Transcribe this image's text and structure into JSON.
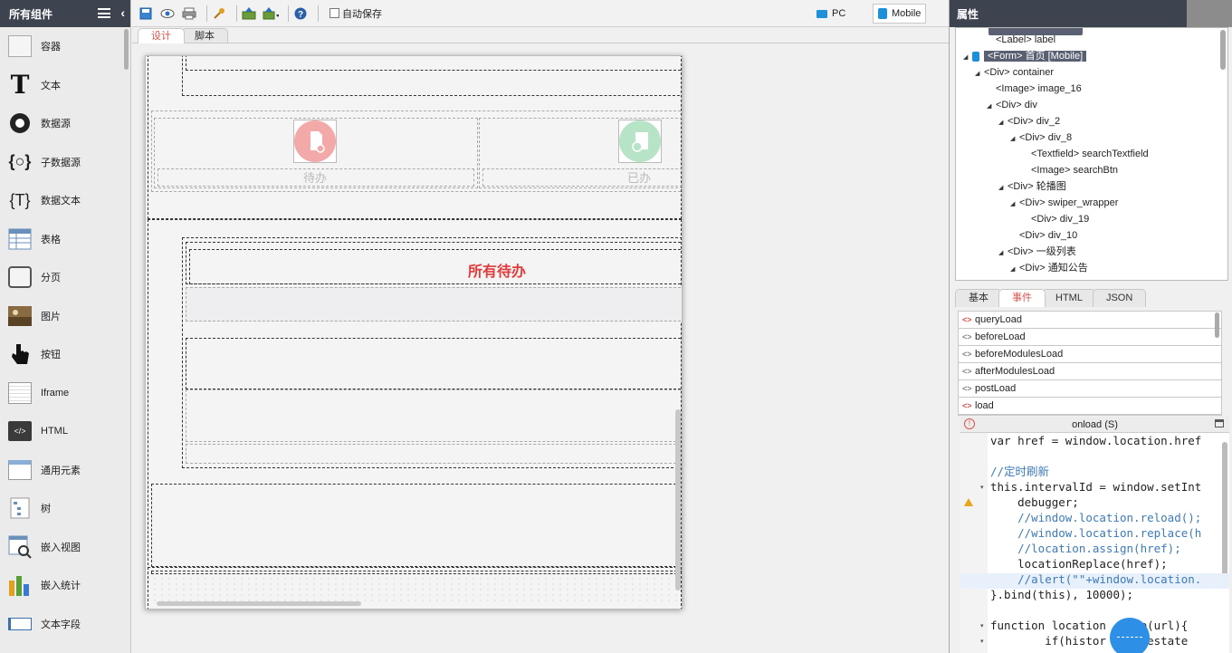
{
  "palette": {
    "title": "所有组件",
    "items": [
      {
        "label": "容器",
        "icon": "container-icon"
      },
      {
        "label": "文本",
        "icon": "text-icon"
      },
      {
        "label": "数据源",
        "icon": "datasource-icon"
      },
      {
        "label": "子数据源",
        "icon": "sub-datasource-icon"
      },
      {
        "label": "数据文本",
        "icon": "data-text-icon"
      },
      {
        "label": "表格",
        "icon": "table-icon"
      },
      {
        "label": "分页",
        "icon": "pagination-icon"
      },
      {
        "label": "图片",
        "icon": "image-icon"
      },
      {
        "label": "按钮",
        "icon": "button-icon"
      },
      {
        "label": "Iframe",
        "icon": "iframe-icon"
      },
      {
        "label": "HTML",
        "icon": "html-icon"
      },
      {
        "label": "通用元素",
        "icon": "generic-element-icon"
      },
      {
        "label": "树",
        "icon": "tree-icon"
      },
      {
        "label": "嵌入视图",
        "icon": "embed-view-icon"
      },
      {
        "label": "嵌入统计",
        "icon": "embed-stats-icon"
      },
      {
        "label": "文本字段",
        "icon": "text-field-icon"
      }
    ]
  },
  "toolbar": {
    "autosave_label": "自动保存",
    "pc_label": "PC",
    "mobile_label": "Mobile"
  },
  "design_tabs": [
    {
      "label": "设计"
    },
    {
      "label": "脚本"
    }
  ],
  "canvas": {
    "todo_label": "待办",
    "done_label": "已办",
    "all_pending_label": "所有待办"
  },
  "right_panel": {
    "title": "属性",
    "tree": [
      {
        "text": "<Label> label",
        "indent": 2,
        "arrow": ""
      },
      {
        "text": "<Form> 首页 [Mobile]",
        "indent": 0,
        "arrow": "◢",
        "selected": true,
        "icon": true
      },
      {
        "text": "<Div> container",
        "indent": 1,
        "arrow": "◢"
      },
      {
        "text": "<Image> image_16",
        "indent": 2,
        "arrow": ""
      },
      {
        "text": "<Div> div",
        "indent": 2,
        "arrow": "◢"
      },
      {
        "text": "<Div> div_2",
        "indent": 3,
        "arrow": "◢"
      },
      {
        "text": "<Div> div_8",
        "indent": 4,
        "arrow": "◢"
      },
      {
        "text": "<Textfield> searchTextfield",
        "indent": 5,
        "arrow": ""
      },
      {
        "text": "<Image> searchBtn",
        "indent": 5,
        "arrow": ""
      },
      {
        "text": "<Div> 轮播图",
        "indent": 3,
        "arrow": "◢"
      },
      {
        "text": "<Div> swiper_wrapper",
        "indent": 4,
        "arrow": "◢"
      },
      {
        "text": "<Div> div_19",
        "indent": 5,
        "arrow": ""
      },
      {
        "text": "<Div> div_10",
        "indent": 4,
        "arrow": ""
      },
      {
        "text": "<Div> 一级列表",
        "indent": 3,
        "arrow": "◢"
      },
      {
        "text": "<Div> 通知公告",
        "indent": 4,
        "arrow": "◢"
      }
    ],
    "prop_tabs": [
      {
        "label": "基本"
      },
      {
        "label": "事件"
      },
      {
        "label": "HTML"
      },
      {
        "label": "JSON"
      }
    ],
    "events": [
      {
        "label": "queryLoad",
        "active": true
      },
      {
        "label": "beforeLoad",
        "active": false
      },
      {
        "label": "beforeModulesLoad",
        "active": false
      },
      {
        "label": "afterModulesLoad",
        "active": false
      },
      {
        "label": "postLoad",
        "active": false
      },
      {
        "label": "load",
        "active": true
      }
    ],
    "editor_title": "onload (S)",
    "code": [
      "var href = window.location.href",
      "",
      "//定时刷新",
      "this.intervalId = window.setInt",
      "    debugger;",
      "    //window.location.reload();",
      "    //window.location.replace(h",
      "    //location.assign(href);",
      "    locationReplace(href);",
      "    //alert(\"\"+window.location.",
      "}.bind(this), 10000);",
      "",
      "function location    ce(url){",
      "        if(histor   .acestate"
    ]
  }
}
